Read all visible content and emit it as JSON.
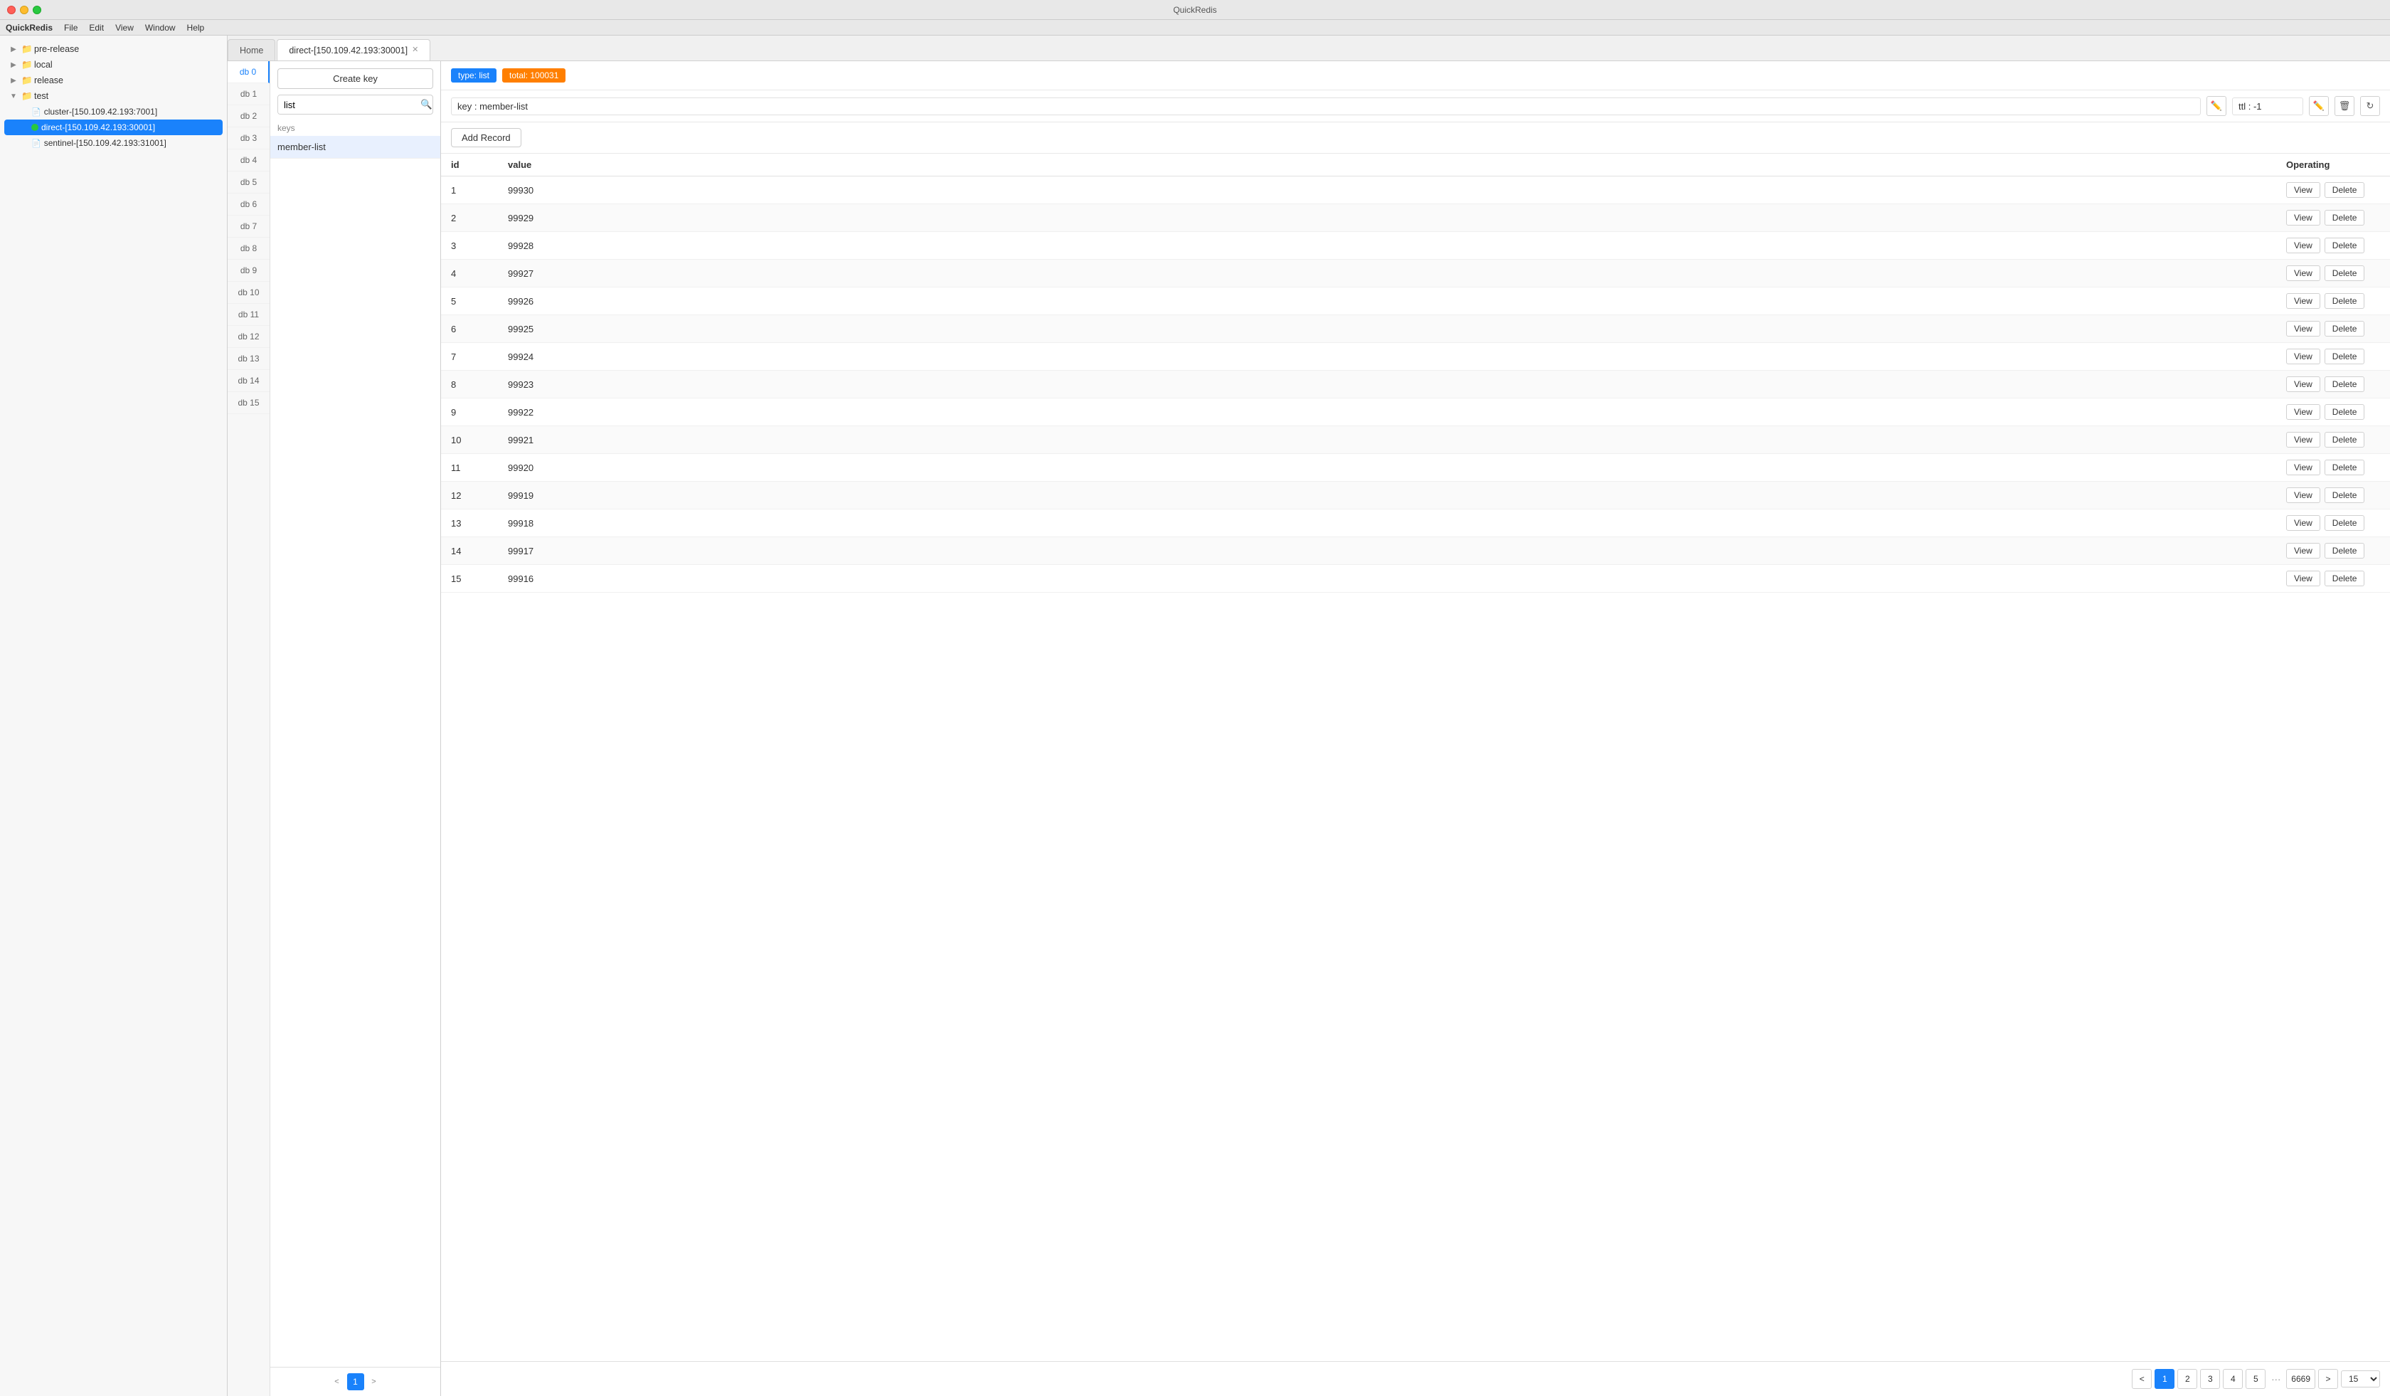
{
  "titlebar": {
    "title": "QuickRedis",
    "app_name": "QuickRedis"
  },
  "menubar": {
    "items": [
      "QuickRedis",
      "File",
      "Edit",
      "View",
      "Window",
      "Help"
    ]
  },
  "sidebar": {
    "items": [
      {
        "id": "pre-release",
        "label": "pre-release",
        "level": 0,
        "type": "folder",
        "expanded": false
      },
      {
        "id": "local",
        "label": "local",
        "level": 0,
        "type": "folder",
        "expanded": false
      },
      {
        "id": "release",
        "label": "release",
        "level": 0,
        "type": "folder",
        "expanded": false
      },
      {
        "id": "test",
        "label": "test",
        "level": 0,
        "type": "folder",
        "expanded": true
      },
      {
        "id": "cluster",
        "label": "cluster-[150.109.42.193:7001]",
        "level": 1,
        "type": "file",
        "expanded": false
      },
      {
        "id": "direct",
        "label": "direct-[150.109.42.193:30001]",
        "level": 1,
        "type": "connected",
        "expanded": false,
        "selected": true
      },
      {
        "id": "sentinel",
        "label": "sentinel-[150.109.42.193:31001]",
        "level": 1,
        "type": "file",
        "expanded": false
      }
    ]
  },
  "tabs": [
    {
      "id": "home",
      "label": "Home",
      "closeable": false,
      "active": false
    },
    {
      "id": "direct",
      "label": "direct-[150.109.42.193:30001]",
      "closeable": true,
      "active": true
    }
  ],
  "db_tabs": [
    {
      "id": "db0",
      "label": "db 0",
      "active": true
    },
    {
      "id": "db1",
      "label": "db 1",
      "active": false
    },
    {
      "id": "db2",
      "label": "db 2",
      "active": false
    },
    {
      "id": "db3",
      "label": "db 3",
      "active": false
    },
    {
      "id": "db4",
      "label": "db 4",
      "active": false
    },
    {
      "id": "db5",
      "label": "db 5",
      "active": false
    },
    {
      "id": "db6",
      "label": "db 6",
      "active": false
    },
    {
      "id": "db7",
      "label": "db 7",
      "active": false
    },
    {
      "id": "db8",
      "label": "db 8",
      "active": false
    },
    {
      "id": "db9",
      "label": "db 9",
      "active": false
    },
    {
      "id": "db10",
      "label": "db 10",
      "active": false
    },
    {
      "id": "db11",
      "label": "db 11",
      "active": false
    },
    {
      "id": "db12",
      "label": "db 12",
      "active": false
    },
    {
      "id": "db13",
      "label": "db 13",
      "active": false
    },
    {
      "id": "db14",
      "label": "db 14",
      "active": false
    },
    {
      "id": "db15",
      "label": "db 15",
      "active": false
    }
  ],
  "keys_panel": {
    "create_key_label": "Create key",
    "search_placeholder": "list",
    "keys_header": "keys",
    "keys": [
      {
        "id": "member-list",
        "label": "member-list",
        "selected": true
      }
    ],
    "pagination": {
      "prev": "<",
      "next": ">",
      "current": "1"
    }
  },
  "detail": {
    "type_badge": "type: list",
    "total_badge": "total: 100031",
    "key_name": "key : member-list",
    "ttl": "ttl : -1",
    "add_record_label": "Add Record",
    "columns": [
      "id",
      "value",
      "Operating"
    ],
    "rows": [
      {
        "id": "1",
        "value": "99930"
      },
      {
        "id": "2",
        "value": "99929"
      },
      {
        "id": "3",
        "value": "99928"
      },
      {
        "id": "4",
        "value": "99927"
      },
      {
        "id": "5",
        "value": "99926"
      },
      {
        "id": "6",
        "value": "99925"
      },
      {
        "id": "7",
        "value": "99924"
      },
      {
        "id": "8",
        "value": "99923"
      },
      {
        "id": "9",
        "value": "99922"
      },
      {
        "id": "10",
        "value": "99921"
      },
      {
        "id": "11",
        "value": "99920"
      },
      {
        "id": "12",
        "value": "99919"
      },
      {
        "id": "13",
        "value": "99918"
      },
      {
        "id": "14",
        "value": "99917"
      },
      {
        "id": "15",
        "value": "99916"
      }
    ],
    "row_actions": {
      "view": "View",
      "delete": "Delete"
    },
    "pagination": {
      "prev": "<",
      "next": ">",
      "pages": [
        "1",
        "2",
        "3",
        "4",
        "5"
      ],
      "dots": "···",
      "last": "6669",
      "current": "1",
      "per_page": "15"
    }
  }
}
